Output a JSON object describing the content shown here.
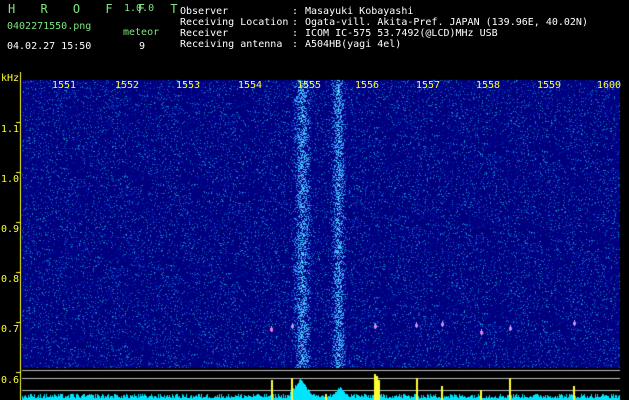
{
  "app": {
    "brand": "H R O F F T",
    "version": "1.0.0"
  },
  "file": {
    "name": "0402271550.png",
    "datetime": "04.02.27  15:50"
  },
  "counter": {
    "label": "meteor",
    "value": "9"
  },
  "info": [
    {
      "key": "Observer",
      "value": "Masayuki Kobayashi"
    },
    {
      "key": "Receiving Location",
      "value": "Ogata-vill. Akita-Pref. JAPAN (139.96E, 40.02N)"
    },
    {
      "key": "Receiver",
      "value": "ICOM IC-575 53.7492(@LCD)MHz USB"
    },
    {
      "key": "Receiving antenna",
      "value": "A504HB(yagi 4el)"
    }
  ],
  "separator": ":",
  "axis": {
    "x_labels": [
      "1551",
      "1552",
      "1553",
      "1554",
      "1555",
      "1556",
      "1557",
      "1558",
      "1559",
      "1600"
    ],
    "y_unit": "kHz",
    "y_labels": [
      "1.1",
      "1.0",
      "0.9",
      "0.8",
      "0.7",
      "0.6"
    ]
  },
  "colors": {
    "header_text": "#7fe47f",
    "info_text": "#ffffff",
    "axis": "#ffff33",
    "background": "#000000",
    "waterfall_base": "#00008a",
    "amplitude": "#00e5ff"
  }
}
